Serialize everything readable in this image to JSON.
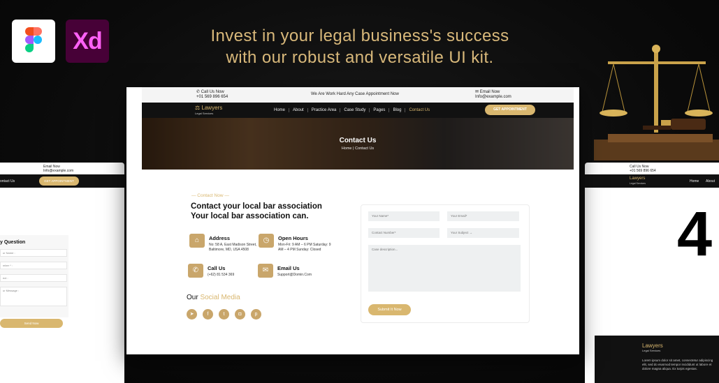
{
  "headline": {
    "line1": "Invest in your legal business's success",
    "line2": "with our robust and versatile UI kit."
  },
  "apps": {
    "xd_label": "Xd"
  },
  "mock": {
    "topbar": {
      "call_label": "Call Us Now",
      "call_value": "+01 569 896 654",
      "notice": "We Are Work Hard Any Case Appointment Now",
      "email_label": "Email Now",
      "email_value": "Info@example.com"
    },
    "nav": {
      "brand": "Lawyers",
      "brand_sub": "Legal Services",
      "links": [
        "Home",
        "About",
        "Practice Area",
        "Case Study",
        "Pages",
        "Blog",
        "Contact Us"
      ],
      "cta": "GET APPOINTMENT"
    },
    "hero": {
      "title": "Contact Us",
      "breadcrumb": "Home | Contact Us"
    },
    "eyebrow": "— Contact Now —",
    "heading_line1": "Contact your local bar association",
    "heading_line2": "Your local bar association can.",
    "info": {
      "address_label": "Address",
      "address_value": "No: 58 A, East Madison Street, Baltimore, MD, USA 4508",
      "hours_label": "Open Hours",
      "hours_value": "Mon-Fri: 9 AM – 6 PM Saturday: 9 AM – 4 PM Sunday: Closed",
      "call_label": "Call Us",
      "call_value": "(+62) 81 534 369",
      "email_label": "Email Us",
      "email_value": "Support@Domin.Com"
    },
    "social": {
      "prefix": "Our",
      "highlight": "Social Media"
    },
    "form": {
      "name": "Your Name*",
      "email": "Your Email*",
      "number": "Contact Number*",
      "subject": "Your Subject →",
      "description": "Case description...",
      "submit": "Submit It Now"
    }
  },
  "left_panel": {
    "email_label": "Email Now",
    "email_value": "Info@example.com",
    "nav_link": "ontact Us",
    "cta": "GET APPOINTMENT",
    "form_title": "y Question",
    "fields": [
      "ur Name :",
      "mber * :",
      "ect :",
      "ur Message :"
    ],
    "submit": "Send Now"
  },
  "right_panel": {
    "call_label": "Call Us Now",
    "call_value": "+01 569 896 654",
    "links": [
      "Home",
      "About"
    ],
    "big": "4",
    "brand": "Lawyers",
    "brand_sub": "Legal Services",
    "footer_text": "Lorem ipsum dolor sit amet, consectetur adipiscing elit, sed do eiusmod tempor incididunt ut labore et dolore magna aliqua. Ex turpis egestas."
  }
}
